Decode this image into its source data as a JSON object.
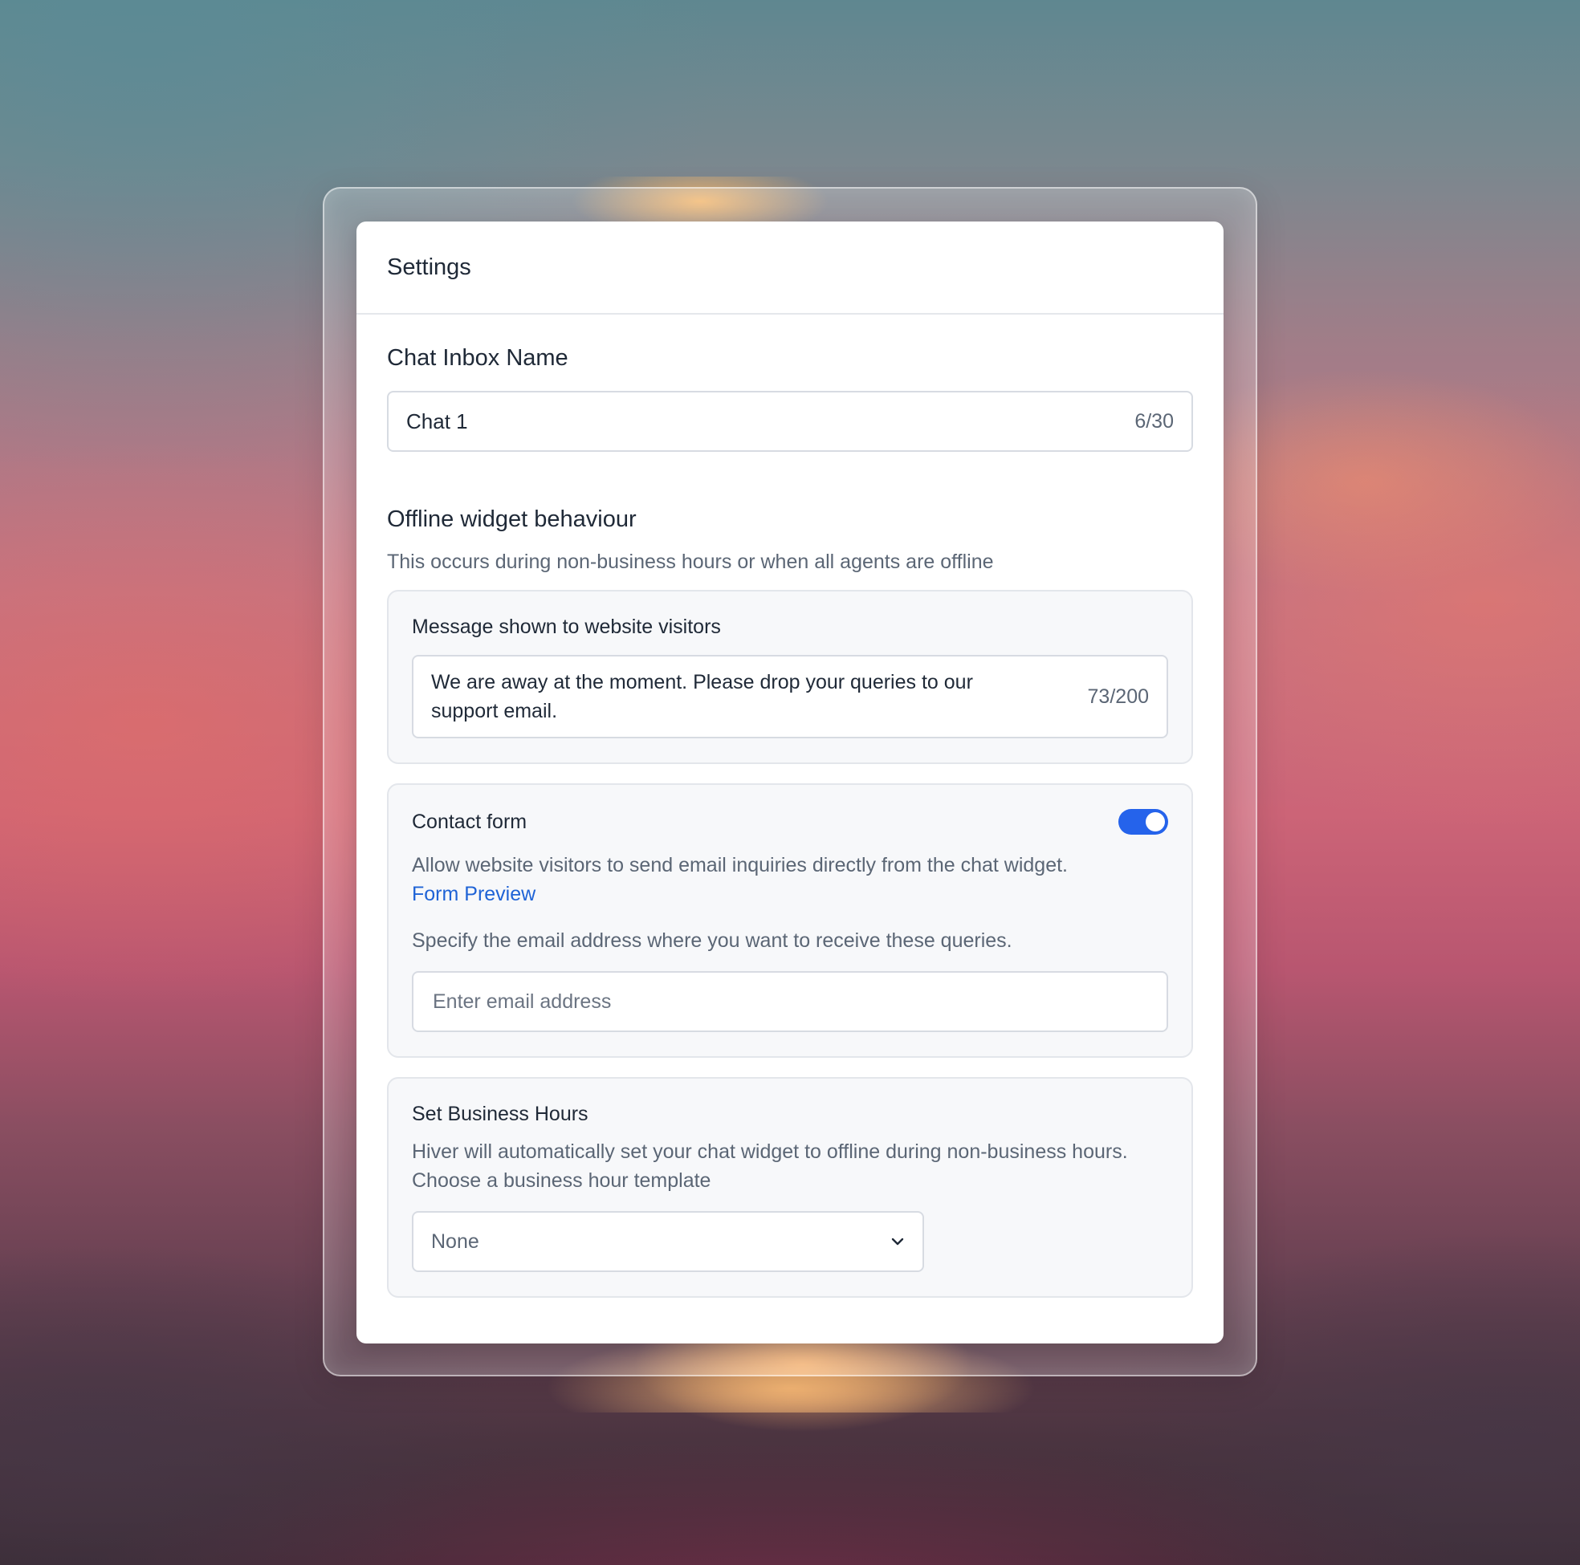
{
  "header": {
    "title": "Settings"
  },
  "inbox_name": {
    "label": "Chat Inbox Name",
    "value": "Chat 1",
    "counter": "6/30"
  },
  "offline": {
    "heading": "Offline widget behaviour",
    "description": "This occurs during non-business hours or when all agents are offline",
    "message_panel": {
      "title": "Message shown to website visitors",
      "message": "We are away at the moment. Please drop your queries to our support email.",
      "counter": "73/200"
    },
    "contact_form": {
      "title": "Contact form",
      "toggle_on": true,
      "description": "Allow website visitors to send email inquiries directly from the chat widget.",
      "link_label": "Form Preview",
      "email_instruction": "Specify the email address where you want to receive these queries.",
      "email_placeholder": "Enter email address",
      "email_value": ""
    },
    "business_hours": {
      "title": "Set Business Hours",
      "description": "Hiver will automatically set your chat widget to offline during non-business hours. Choose a business hour template",
      "selected_template": "None"
    }
  },
  "icons": {
    "dropdown": "chevron-down-icon"
  },
  "colors": {
    "accent": "#2563eb",
    "link": "#1f63d6"
  }
}
